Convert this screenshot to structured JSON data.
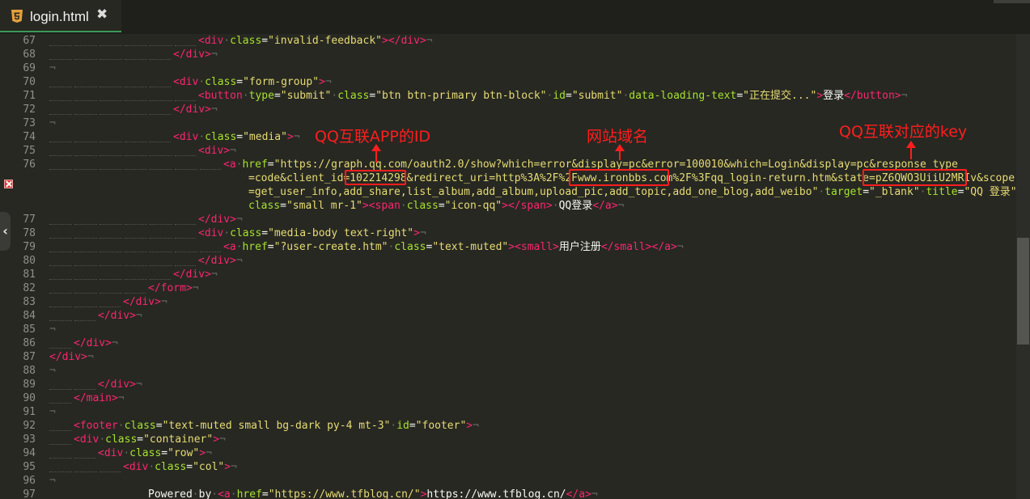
{
  "tab": {
    "title": "login.html",
    "close_label": "✖"
  },
  "accent": "#ff1e1e",
  "annotations": [
    {
      "label": "QQ互联APP的ID"
    },
    {
      "label": "网站域名"
    },
    {
      "label": "QQ互联对应的key"
    }
  ],
  "line_numbers": [
    "67",
    "68",
    "69",
    "70",
    "71",
    "72",
    "73",
    "74",
    "75",
    "76",
    "",
    "",
    "",
    "77",
    "78",
    "79",
    "80",
    "81",
    "82",
    "83",
    "84",
    "85",
    "86",
    "87",
    "88",
    "89",
    "90",
    "91",
    "92",
    "93",
    "94",
    "95",
    "96",
    "97"
  ],
  "code_lines": [
    [
      {
        "k": "t",
        "v": "<div"
      },
      {
        "k": "p",
        "v": "·"
      },
      {
        "k": "a",
        "v": "class"
      },
      {
        "k": "w",
        "v": "="
      },
      {
        "k": "s",
        "v": "\"invalid-feedback\""
      },
      {
        "k": "t",
        "v": ">"
      },
      {
        "k": "t",
        "v": "</div>"
      },
      {
        "k": "p",
        "v": "¬"
      }
    ],
    [
      {
        "k": "t",
        "v": "</div>"
      },
      {
        "k": "p",
        "v": "¬"
      }
    ],
    [
      {
        "k": "p",
        "v": "¬"
      }
    ],
    [
      {
        "k": "t",
        "v": "<div"
      },
      {
        "k": "p",
        "v": "·"
      },
      {
        "k": "a",
        "v": "class"
      },
      {
        "k": "w",
        "v": "="
      },
      {
        "k": "s",
        "v": "\"form-group\""
      },
      {
        "k": "t",
        "v": ">"
      },
      {
        "k": "p",
        "v": "¬"
      }
    ],
    [
      {
        "k": "t",
        "v": "<button"
      },
      {
        "k": "p",
        "v": "·"
      },
      {
        "k": "a",
        "v": "type"
      },
      {
        "k": "w",
        "v": "="
      },
      {
        "k": "s",
        "v": "\"submit\""
      },
      {
        "k": "p",
        "v": "·"
      },
      {
        "k": "a",
        "v": "class"
      },
      {
        "k": "w",
        "v": "="
      },
      {
        "k": "s",
        "v": "\"btn btn-primary btn-block\""
      },
      {
        "k": "p",
        "v": "·"
      },
      {
        "k": "a",
        "v": "id"
      },
      {
        "k": "w",
        "v": "="
      },
      {
        "k": "s",
        "v": "\"submit\""
      },
      {
        "k": "p",
        "v": "·"
      },
      {
        "k": "a",
        "v": "data-loading-text"
      },
      {
        "k": "w",
        "v": "="
      },
      {
        "k": "s",
        "v": "\"正在提交...\""
      },
      {
        "k": "t",
        "v": ">"
      },
      {
        "k": "w",
        "v": "登录"
      },
      {
        "k": "t",
        "v": "</button>"
      },
      {
        "k": "p",
        "v": "¬"
      }
    ],
    [
      {
        "k": "t",
        "v": "</div>"
      },
      {
        "k": "p",
        "v": "¬"
      }
    ],
    [
      {
        "k": "p",
        "v": "¬"
      }
    ],
    [
      {
        "k": "t",
        "v": "<div"
      },
      {
        "k": "p",
        "v": "·"
      },
      {
        "k": "a",
        "v": "class"
      },
      {
        "k": "w",
        "v": "="
      },
      {
        "k": "s",
        "v": "\"media\""
      },
      {
        "k": "t",
        "v": ">"
      },
      {
        "k": "p",
        "v": "¬"
      }
    ],
    [
      {
        "k": "t",
        "v": "<div>"
      },
      {
        "k": "p",
        "v": "¬"
      }
    ],
    [
      {
        "k": "t",
        "v": "<a"
      },
      {
        "k": "p",
        "v": "·"
      },
      {
        "k": "a",
        "v": "href"
      },
      {
        "k": "w",
        "v": "="
      },
      {
        "k": "s",
        "v": "\"https://graph.qq.com/oauth2.0/show?which=error&display=pc&error=100010&which=Login&display=pc&response_type"
      }
    ],
    [
      {
        "k": "s",
        "v": "=code&client_id=102214298&redirect_uri=http%3A%2F%2Fwww.ironbbs.com%2F%3Fqq_login-return.htm&state=pZ6QWO3UiiU2MRIv&scope"
      }
    ],
    [
      {
        "k": "s",
        "v": "=get_user_info,add_share,list_album,add_album,upload_pic,add_topic,add_one_blog,add_weibo\""
      },
      {
        "k": "p",
        "v": "·"
      },
      {
        "k": "a",
        "v": "target"
      },
      {
        "k": "w",
        "v": "="
      },
      {
        "k": "s",
        "v": "\"_blank\""
      },
      {
        "k": "p",
        "v": "·"
      },
      {
        "k": "a",
        "v": "title"
      },
      {
        "k": "w",
        "v": "="
      },
      {
        "k": "s",
        "v": "\"QQ 登录\""
      }
    ],
    [
      {
        "k": "a",
        "v": "class"
      },
      {
        "k": "w",
        "v": "="
      },
      {
        "k": "s",
        "v": "\"small mr-1\""
      },
      {
        "k": "t",
        "v": ">"
      },
      {
        "k": "t",
        "v": "<span"
      },
      {
        "k": "p",
        "v": "·"
      },
      {
        "k": "a",
        "v": "class"
      },
      {
        "k": "w",
        "v": "="
      },
      {
        "k": "s",
        "v": "\"icon-qq\""
      },
      {
        "k": "t",
        "v": ">"
      },
      {
        "k": "t",
        "v": "</span>"
      },
      {
        "k": "p",
        "v": "·"
      },
      {
        "k": "w",
        "v": "QQ登录"
      },
      {
        "k": "t",
        "v": "</a>"
      },
      {
        "k": "p",
        "v": "¬"
      }
    ],
    [
      {
        "k": "t",
        "v": "</div>"
      },
      {
        "k": "p",
        "v": "¬"
      }
    ],
    [
      {
        "k": "t",
        "v": "<div"
      },
      {
        "k": "p",
        "v": "·"
      },
      {
        "k": "a",
        "v": "class"
      },
      {
        "k": "w",
        "v": "="
      },
      {
        "k": "s",
        "v": "\"media-body text-right\""
      },
      {
        "k": "t",
        "v": ">"
      },
      {
        "k": "p",
        "v": "¬"
      }
    ],
    [
      {
        "k": "t",
        "v": "<a"
      },
      {
        "k": "p",
        "v": "·"
      },
      {
        "k": "a",
        "v": "href"
      },
      {
        "k": "w",
        "v": "="
      },
      {
        "k": "s",
        "v": "\"?user-create.htm\""
      },
      {
        "k": "p",
        "v": "·"
      },
      {
        "k": "a",
        "v": "class"
      },
      {
        "k": "w",
        "v": "="
      },
      {
        "k": "s",
        "v": "\"text-muted\""
      },
      {
        "k": "t",
        "v": ">"
      },
      {
        "k": "t",
        "v": "<small>"
      },
      {
        "k": "w",
        "v": "用户注册"
      },
      {
        "k": "t",
        "v": "</small>"
      },
      {
        "k": "t",
        "v": "</a>"
      },
      {
        "k": "p",
        "v": "¬"
      }
    ],
    [
      {
        "k": "t",
        "v": "</div>"
      },
      {
        "k": "p",
        "v": "¬"
      }
    ],
    [
      {
        "k": "t",
        "v": "</div>"
      },
      {
        "k": "p",
        "v": "¬"
      }
    ],
    [
      {
        "k": "t",
        "v": "</form>"
      },
      {
        "k": "p",
        "v": "¬"
      }
    ],
    [
      {
        "k": "t",
        "v": "</div>"
      },
      {
        "k": "p",
        "v": "¬"
      }
    ],
    [
      {
        "k": "t",
        "v": "</div>"
      },
      {
        "k": "p",
        "v": "¬"
      }
    ],
    [
      {
        "k": "p",
        "v": "¬"
      }
    ],
    [
      {
        "k": "t",
        "v": "</div>"
      },
      {
        "k": "p",
        "v": "¬"
      }
    ],
    [
      {
        "k": "t",
        "v": "</div>"
      },
      {
        "k": "p",
        "v": "¬"
      }
    ],
    [
      {
        "k": "p",
        "v": "¬"
      }
    ],
    [
      {
        "k": "t",
        "v": "</div>"
      },
      {
        "k": "p",
        "v": "¬"
      }
    ],
    [
      {
        "k": "t",
        "v": "</main>"
      },
      {
        "k": "p",
        "v": "¬"
      }
    ],
    [
      {
        "k": "p",
        "v": "¬"
      }
    ],
    [
      {
        "k": "t",
        "v": "<footer"
      },
      {
        "k": "p",
        "v": "·"
      },
      {
        "k": "a",
        "v": "class"
      },
      {
        "k": "w",
        "v": "="
      },
      {
        "k": "s",
        "v": "\"text-muted small bg-dark py-4 mt-3\""
      },
      {
        "k": "p",
        "v": "·"
      },
      {
        "k": "a",
        "v": "id"
      },
      {
        "k": "w",
        "v": "="
      },
      {
        "k": "s",
        "v": "\"footer\""
      },
      {
        "k": "t",
        "v": ">"
      },
      {
        "k": "p",
        "v": "¬"
      }
    ],
    [
      {
        "k": "t",
        "v": "<div"
      },
      {
        "k": "p",
        "v": "·"
      },
      {
        "k": "a",
        "v": "class"
      },
      {
        "k": "w",
        "v": "="
      },
      {
        "k": "s",
        "v": "\"container\""
      },
      {
        "k": "t",
        "v": ">"
      },
      {
        "k": "p",
        "v": "¬"
      }
    ],
    [
      {
        "k": "t",
        "v": "<div"
      },
      {
        "k": "p",
        "v": "·"
      },
      {
        "k": "a",
        "v": "class"
      },
      {
        "k": "w",
        "v": "="
      },
      {
        "k": "s",
        "v": "\"row\""
      },
      {
        "k": "t",
        "v": ">"
      },
      {
        "k": "p",
        "v": "¬"
      }
    ],
    [
      {
        "k": "t",
        "v": "<div"
      },
      {
        "k": "p",
        "v": "·"
      },
      {
        "k": "a",
        "v": "class"
      },
      {
        "k": "w",
        "v": "="
      },
      {
        "k": "s",
        "v": "\"col\""
      },
      {
        "k": "t",
        "v": ">"
      },
      {
        "k": "p",
        "v": "¬"
      }
    ],
    [
      {
        "k": "p",
        "v": "¬"
      }
    ],
    [
      {
        "k": "w",
        "v": "Powered"
      },
      {
        "k": "p",
        "v": "·"
      },
      {
        "k": "w",
        "v": "by"
      },
      {
        "k": "p",
        "v": "·"
      },
      {
        "k": "t",
        "v": "<a"
      },
      {
        "k": "p",
        "v": "·"
      },
      {
        "k": "a",
        "v": "href"
      },
      {
        "k": "w",
        "v": "="
      },
      {
        "k": "s",
        "v": "\"https://www.tfblog.cn/\""
      },
      {
        "k": "t",
        "v": ">"
      },
      {
        "k": "w",
        "v": "https://www.tfblog.cn/"
      },
      {
        "k": "t",
        "v": "</a>"
      },
      {
        "k": "p",
        "v": "¬"
      }
    ]
  ]
}
